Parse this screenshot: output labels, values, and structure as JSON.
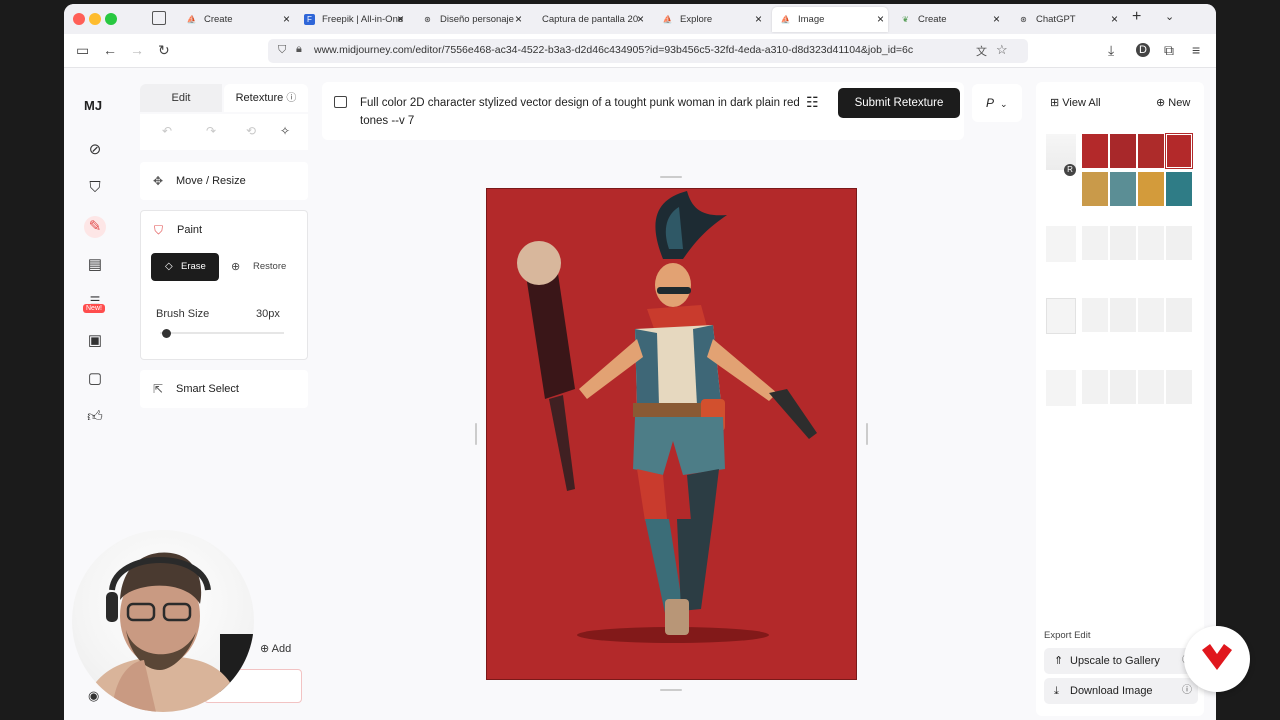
{
  "browser": {
    "tabs": [
      {
        "label": "Create",
        "active": false
      },
      {
        "label": "Freepik | All-in-One",
        "active": false
      },
      {
        "label": "Diseño personaje",
        "active": false
      },
      {
        "label": "Captura de pantalla 20",
        "active": false
      },
      {
        "label": "Explore",
        "active": false
      },
      {
        "label": "Image",
        "active": true
      },
      {
        "label": "Create",
        "active": false
      },
      {
        "label": "ChatGPT",
        "active": false
      }
    ],
    "url": "www.midjourney.com/editor/7556e468-ac34-4522-b3a3-d2d46c434905?id=93b456c5-32fd-4eda-a310-d8d323d41104&job_id=6c"
  },
  "rail": {
    "logo": "MJ",
    "new_badge": "New!",
    "icons": [
      "explore-icon",
      "brush-icon",
      "edit-icon",
      "layers-icon",
      "new-feature-icon",
      "image-icon",
      "chat-icon",
      "thumbs-up-icon"
    ]
  },
  "tool_panel": {
    "tab_edit": "Edit",
    "tab_retexture": "Retexture",
    "move_resize": "Move / Resize",
    "paint": "Paint",
    "erase": "Erase",
    "restore": "Restore",
    "brush_size_label": "Brush Size",
    "brush_size_value": "30px",
    "brush_size_fraction": 0.05,
    "smart_select": "Smart Select",
    "add": "Add"
  },
  "prompt": {
    "text": "Full color 2D character stylized vector design of a tought punk woman in dark plain red tones --v 7",
    "submit": "Submit Retexture",
    "model_select": "P"
  },
  "colors": {
    "artwork_bg": "#b3292a",
    "accent_red": "#e14c4c",
    "primary_button": "#1c1c1c"
  },
  "right_panel": {
    "view_all": "View All",
    "new": "New",
    "export_label": "Export Edit",
    "upscale": "Upscale to Gallery",
    "download": "Download Image",
    "source_badge": "R"
  }
}
